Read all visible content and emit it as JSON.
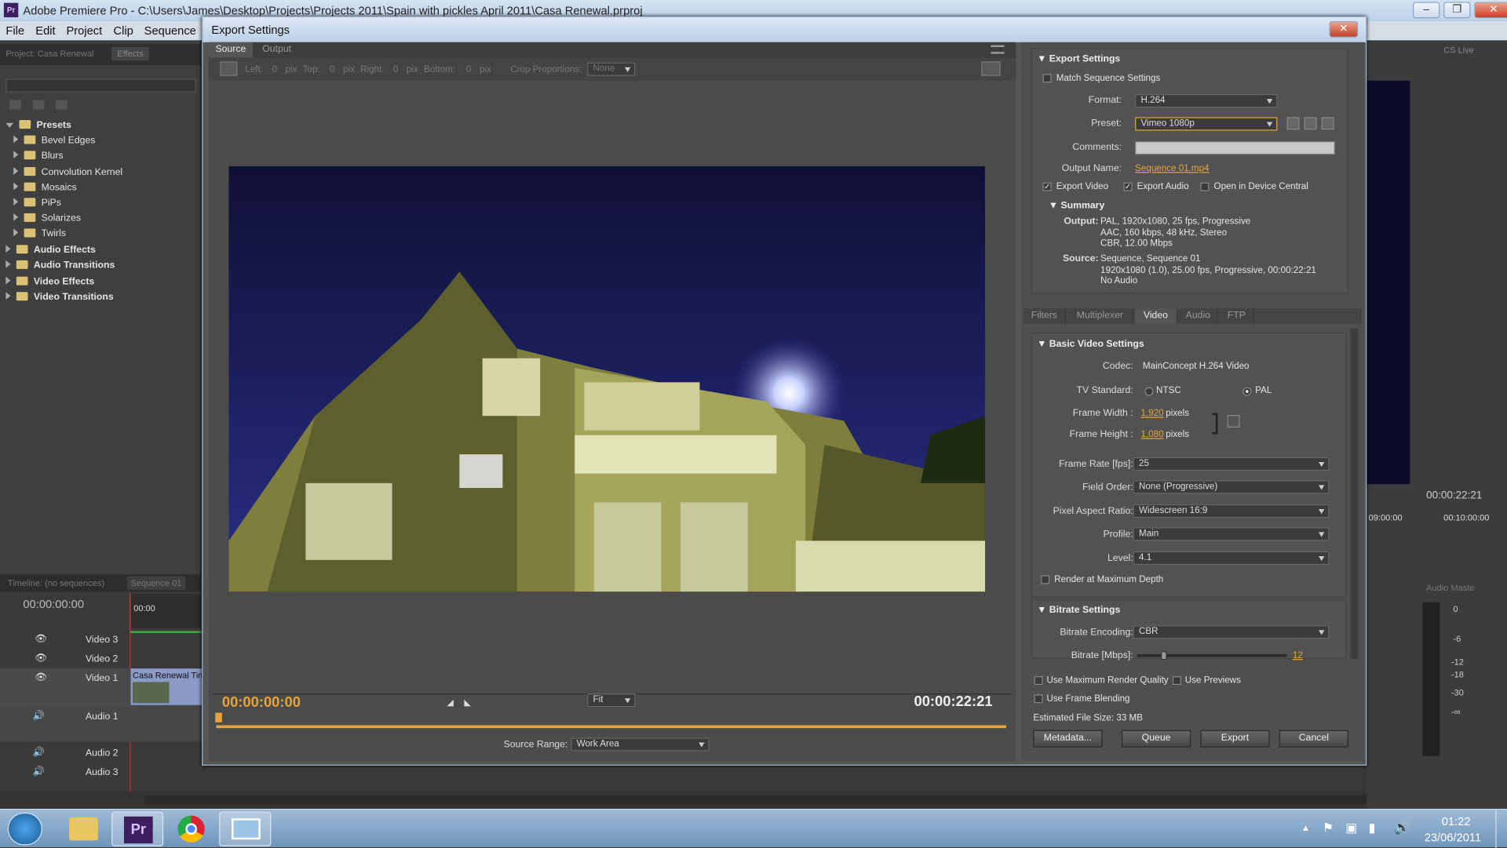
{
  "app": {
    "title": "Adobe Premiere Pro - C:\\Users\\James\\Desktop\\Projects\\Projects 2011\\Spain with pickles April 2011\\Casa Renewal.prproj",
    "logo": "Pr"
  },
  "menu": [
    "File",
    "Edit",
    "Project",
    "Clip",
    "Sequence"
  ],
  "left_panel": {
    "tabs": [
      "Project: Casa Renewal",
      "Effects"
    ],
    "tree": [
      {
        "label": "Presets",
        "level": 0,
        "open": true
      },
      {
        "label": "Bevel Edges",
        "level": 1
      },
      {
        "label": "Blurs",
        "level": 1
      },
      {
        "label": "Convolution Kernel",
        "level": 1
      },
      {
        "label": "Mosaics",
        "level": 1
      },
      {
        "label": "PiPs",
        "level": 1
      },
      {
        "label": "Solarizes",
        "level": 1
      },
      {
        "label": "Twirls",
        "level": 1
      },
      {
        "label": "Audio Effects",
        "level": 0
      },
      {
        "label": "Audio Transitions",
        "level": 0
      },
      {
        "label": "Video Effects",
        "level": 0
      },
      {
        "label": "Video Transitions",
        "level": 0
      }
    ]
  },
  "timeline": {
    "tabs": [
      "Timeline: (no sequences)",
      "Sequence 01"
    ],
    "timecode": "00:00:00:00",
    "ruler_start": "00:00",
    "tracks": [
      "Video 3",
      "Video 2",
      "Video 1",
      "Audio 1",
      "Audio 2",
      "Audio 3"
    ],
    "clip_label": "Casa Renewal Tim"
  },
  "dialog": {
    "title": "Export Settings",
    "source_tabs": [
      "Source",
      "Output"
    ],
    "crop": {
      "left_label": "Left:",
      "left": "0",
      "top_label": "Top:",
      "top": "0",
      "right_label": "Right:",
      "right": "0",
      "bottom_label": "Bottom:",
      "bottom": "0",
      "unit": "pix",
      "proportions_label": "Crop Proportions:",
      "proportions": "None"
    },
    "player": {
      "current": "00:00:00:00",
      "duration": "00:00:22:21",
      "zoom": "Fit",
      "source_range_label": "Source Range:",
      "source_range": "Work Area"
    },
    "export_settings": {
      "header": "Export Settings",
      "match_sequence": "Match Sequence Settings",
      "format_label": "Format:",
      "format": "H.264",
      "preset_label": "Preset:",
      "preset": "Vimeo 1080p",
      "comments_label": "Comments:",
      "output_name_label": "Output Name:",
      "output_name": "Sequence 01.mp4",
      "export_video": "Export Video",
      "export_audio": "Export Audio",
      "device_central": "Open in Device Central",
      "summary_header": "Summary",
      "output_label": "Output:",
      "output_lines": [
        "PAL, 1920x1080, 25 fps, Progressive",
        "AAC, 160 kbps, 48 kHz, Stereo",
        "CBR, 12.00 Mbps"
      ],
      "source_label": "Source:",
      "source_lines": [
        "Sequence, Sequence 01",
        "1920x1080 (1.0), 25.00 fps, Progressive, 00:00:22:21",
        "No Audio"
      ]
    },
    "tabs": [
      "Filters",
      "Multiplexer",
      "Video",
      "Audio",
      "FTP"
    ],
    "active_tab": "Video",
    "video": {
      "header": "Basic Video Settings",
      "codec_label": "Codec:",
      "codec": "MainConcept H.264 Video",
      "tv_label": "TV Standard:",
      "ntsc": "NTSC",
      "pal": "PAL",
      "width_label": "Frame Width :",
      "width": "1,920",
      "height_label": "Frame Height :",
      "height": "1,080",
      "pixels": "pixels",
      "fps_label": "Frame Rate [fps]:",
      "fps": "25",
      "field_label": "Field Order:",
      "field": "None (Progressive)",
      "par_label": "Pixel Aspect Ratio:",
      "par": "Widescreen 16:9",
      "profile_label": "Profile:",
      "profile": "Main",
      "level_label": "Level:",
      "level": "4.1",
      "render_max": "Render at Maximum Depth",
      "bitrate_header": "Bitrate Settings",
      "encoding_label": "Bitrate Encoding:",
      "encoding": "CBR",
      "bitrate_label": "Bitrate [Mbps]:",
      "bitrate": "12",
      "bitrate_fraction": 0.18
    },
    "footer": {
      "max_quality": "Use Maximum Render Quality",
      "previews": "Use Previews",
      "blending": "Use Frame Blending",
      "file_size": "Estimated File Size: 33 MB",
      "metadata": "Metadata...",
      "queue": "Queue",
      "export": "Export",
      "cancel": "Cancel"
    }
  },
  "right_edge": {
    "workspace": "CS Live",
    "tc": "00:00:22:21",
    "ruler": [
      "09:00:00",
      "00:10:00:00"
    ],
    "audio_master": "Audio Maste",
    "meter_marks": [
      "0",
      "-6",
      "-12",
      "-18",
      "-30",
      "-∞"
    ]
  },
  "taskbar": {
    "time": "01:22",
    "date": "23/06/2011"
  },
  "colors": {
    "accent": "#e8a43a",
    "sky": "#14134a",
    "panel": "#4f4f4f"
  }
}
